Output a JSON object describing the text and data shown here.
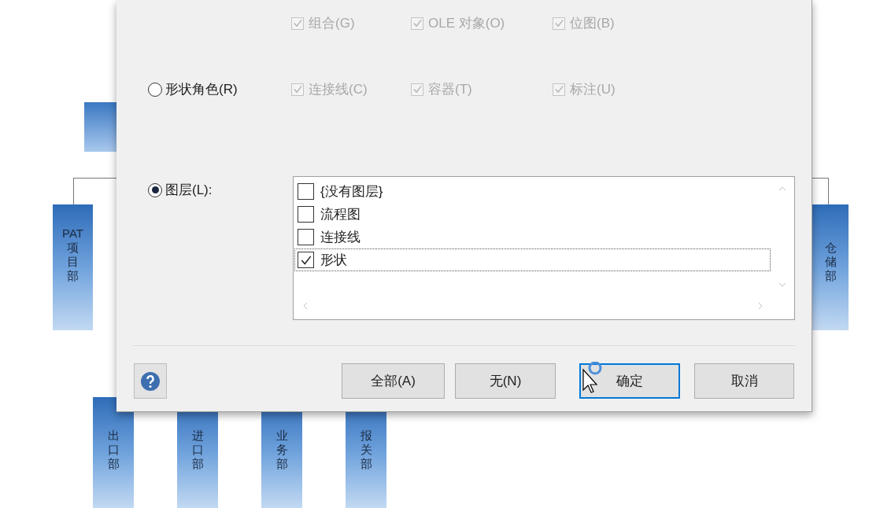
{
  "org_chart": {
    "side_boxes": [
      {
        "label": "PAT项目部"
      },
      {
        "label": "仓储部"
      }
    ],
    "bottom_boxes": [
      {
        "label": "出口部"
      },
      {
        "label": "进口部"
      },
      {
        "label": "业务部"
      },
      {
        "label": "报关部"
      }
    ]
  },
  "dialog": {
    "type_checkboxes": [
      {
        "label": "组合(G)",
        "checked": true,
        "disabled": true
      },
      {
        "label": "OLE 对象(O)",
        "checked": true,
        "disabled": true
      },
      {
        "label": "位图(B)",
        "checked": true,
        "disabled": true
      }
    ],
    "shape_role": {
      "label": "形状角色(R)",
      "selected": false,
      "checkboxes": [
        {
          "label": "连接线(C)",
          "checked": true,
          "disabled": true
        },
        {
          "label": "容器(T)",
          "checked": true,
          "disabled": true
        },
        {
          "label": "标注(U)",
          "checked": true,
          "disabled": true
        }
      ]
    },
    "layer": {
      "label": "图层(L):",
      "selected": true,
      "layers": [
        {
          "label": "{没有图层}",
          "checked": false,
          "focused": false
        },
        {
          "label": "流程图",
          "checked": false,
          "focused": false
        },
        {
          "label": "连接线",
          "checked": false,
          "focused": false
        },
        {
          "label": "形状",
          "checked": true,
          "focused": true
        }
      ]
    },
    "buttons": [
      {
        "label": "全部(A)",
        "default": false
      },
      {
        "label": "无(N)",
        "default": false
      },
      {
        "label": "确定",
        "default": true
      },
      {
        "label": "取消",
        "default": false
      }
    ]
  }
}
